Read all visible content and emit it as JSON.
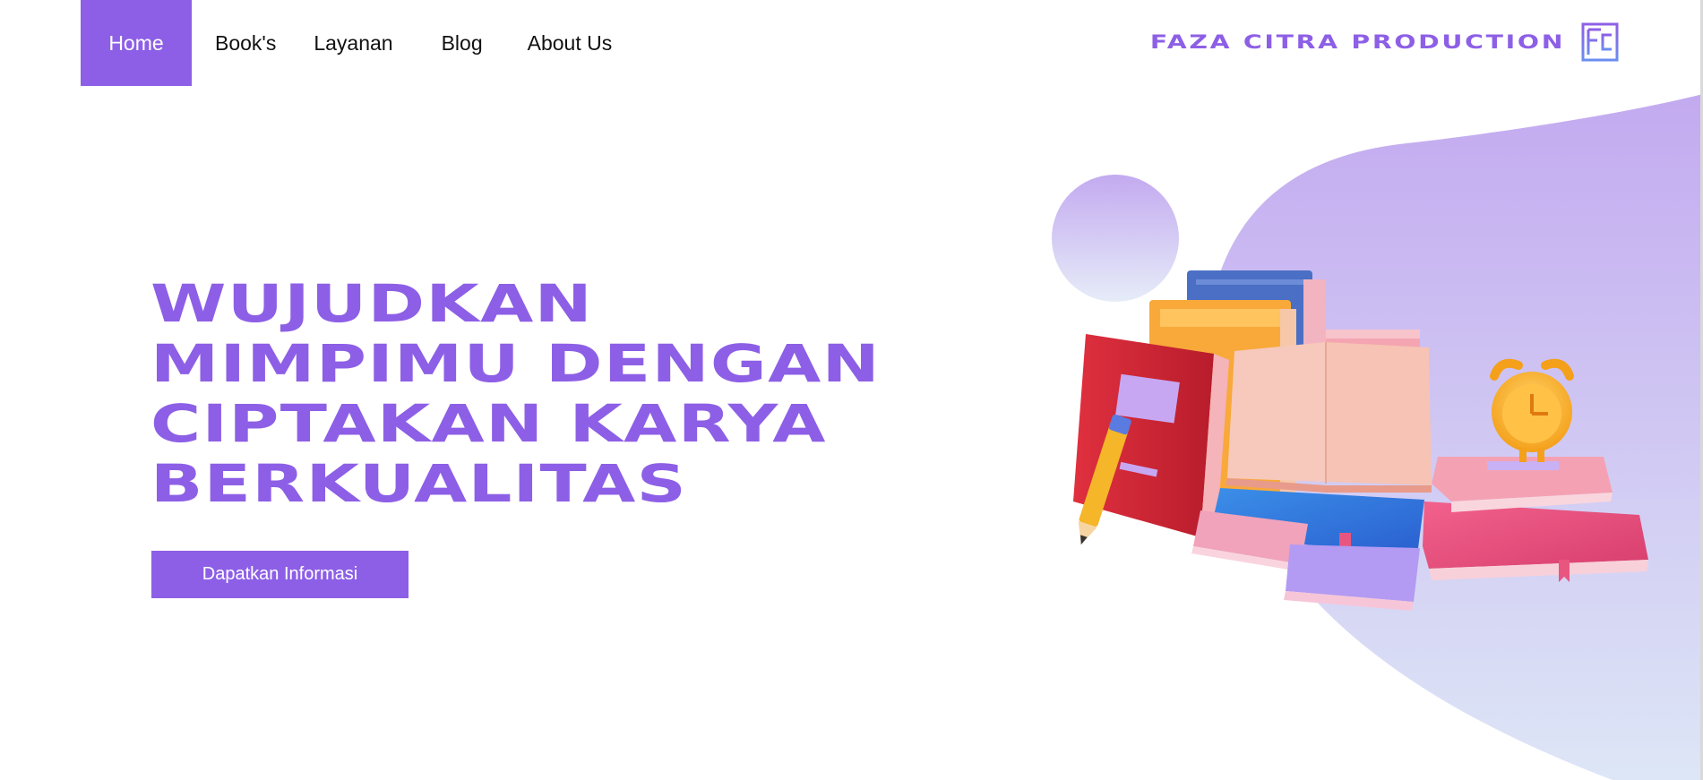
{
  "nav": {
    "items": [
      {
        "label": "Home",
        "active": true
      },
      {
        "label": "Book's",
        "active": false
      },
      {
        "label": "Layanan",
        "active": false
      },
      {
        "label": "Blog",
        "active": false
      },
      {
        "label": "About Us",
        "active": false
      }
    ]
  },
  "brand": {
    "name": "FAZA CITRA PRODUCTION",
    "logo_icon": "fc-monogram-icon"
  },
  "hero": {
    "title_lines": [
      "WUJUDKAN",
      "MIMPIMU DENGAN",
      "CIPTAKAN KARYA",
      "BERKUALITAS"
    ],
    "cta_label": "Dapatkan Informasi"
  },
  "colors": {
    "accent": "#8d5fe6",
    "blob_top": "#c3aaf0",
    "blob_bottom": "#dde6f6",
    "text": "#111111"
  },
  "illustration": {
    "icon": "books-and-clock-illustration"
  }
}
